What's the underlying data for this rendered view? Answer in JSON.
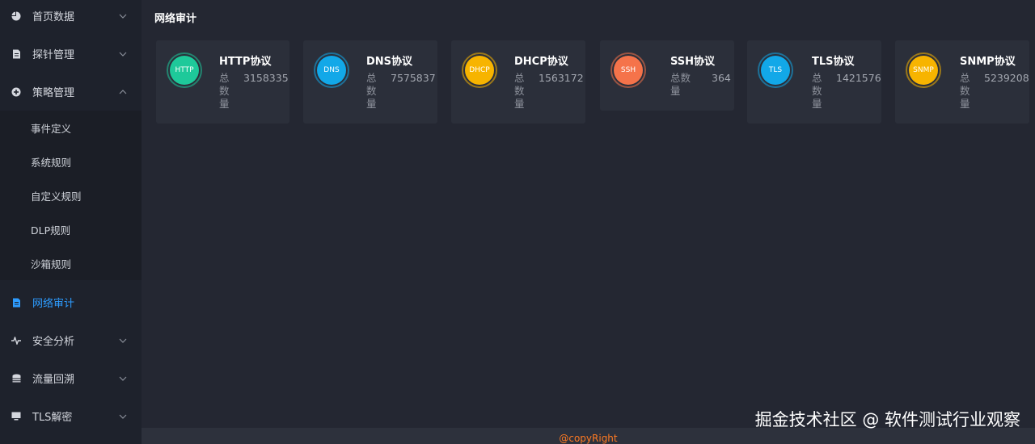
{
  "sidebar": {
    "items": [
      {
        "label": "首页数据",
        "icon": "pie-chart-icon"
      },
      {
        "label": "探针管理",
        "icon": "document-icon"
      },
      {
        "label": "策略管理",
        "icon": "plus-circle-icon"
      },
      {
        "label": "网络审计",
        "icon": "document-icon"
      },
      {
        "label": "安全分析",
        "icon": "pulse-icon"
      },
      {
        "label": "流量回溯",
        "icon": "database-icon"
      },
      {
        "label": "TLS解密",
        "icon": "monitor-icon"
      }
    ],
    "policy_submenu": [
      "事件定义",
      "系统规则",
      "自定义规则",
      "DLP规则",
      "沙箱规则"
    ],
    "active_color": "#2d9cff"
  },
  "page": {
    "title": "网络审计"
  },
  "cards": [
    {
      "badge": "HTTP",
      "name": "HTTP协议",
      "label": "总数量",
      "count": "3158335",
      "color": "#1ec99a"
    },
    {
      "badge": "DNS",
      "name": "DNS协议",
      "label": "总数量",
      "count": "7575837",
      "color": "#12a8e8"
    },
    {
      "badge": "DHCP",
      "name": "DHCP协议",
      "label": "总数量",
      "count": "1563172",
      "color": "#f7b400"
    },
    {
      "badge": "SSH",
      "name": "SSH协议",
      "label": "总数量",
      "count": "364",
      "color": "#f5734a"
    },
    {
      "badge": "TLS",
      "name": "TLS协议",
      "label": "总数量",
      "count": "1421576",
      "color": "#12a8e8"
    },
    {
      "badge": "SNMP",
      "name": "SNMP协议",
      "label": "总数量",
      "count": "5239208",
      "color": "#f7b400"
    }
  ],
  "footer": {
    "copyright": "@copyRight"
  },
  "watermark": "掘金技术社区 @ 软件测试行业观察"
}
